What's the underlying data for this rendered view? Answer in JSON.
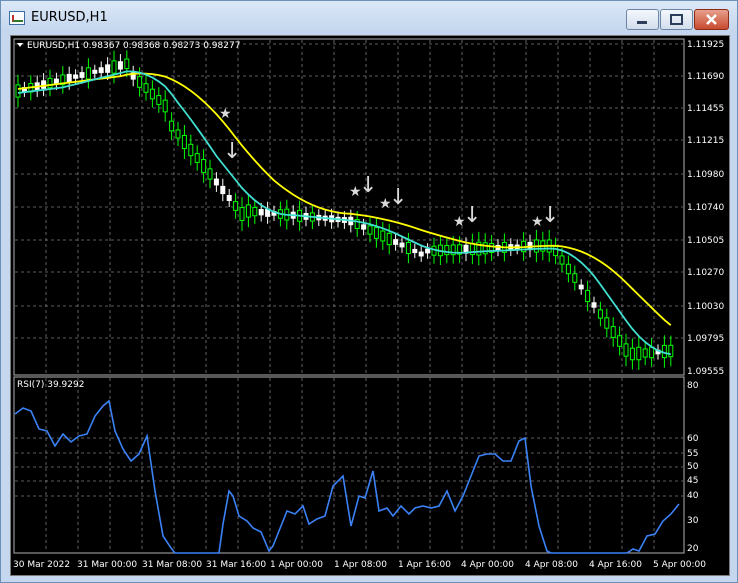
{
  "window": {
    "title": "EURUSD,H1",
    "buttons": [
      "minimize",
      "maximize",
      "close"
    ]
  },
  "main_chart": {
    "symbol_line": "EURUSD,H1  0.98367 0.98368 0.98273 0.98277",
    "price_levels": [
      "1.11925",
      "1.11690",
      "1.11455",
      "1.11215",
      "1.10980",
      "1.10740",
      "1.10505",
      "1.10270",
      "1.10030",
      "1.09795",
      "1.09555"
    ]
  },
  "rsi_panel": {
    "label": "RSI(7) 39.9292",
    "levels": [
      "80",
      "60",
      "55",
      "50",
      "45",
      "40",
      "30",
      "20"
    ]
  },
  "time_axis": {
    "labels": [
      "30 Mar 2022",
      "31 Mar 00:00",
      "31 Mar 08:00",
      "31 Mar 16:00",
      "1 Apr 00:00",
      "1 Apr 08:00",
      "1 Apr 16:00",
      "4 Apr 00:00",
      "4 Apr 08:00",
      "4 Apr 16:00",
      "5 Apr 00:00"
    ]
  },
  "colors": {
    "background": "#000000",
    "grid": "#808080",
    "bull_candle": "#00ff00",
    "bear_candle": "#ffffff",
    "ma_fast": "#40e0d0",
    "ma_slow": "#ffff00",
    "rsi_line": "#3b82f6",
    "markers": "#d9d9d9"
  }
}
